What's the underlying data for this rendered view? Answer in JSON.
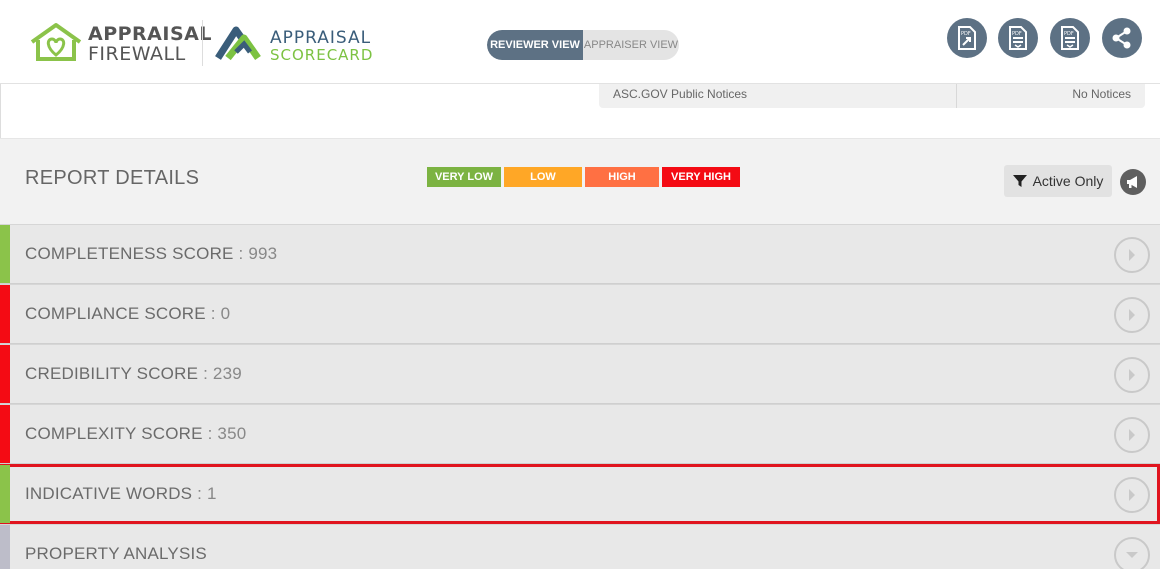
{
  "header": {
    "logo_firewall": {
      "line1": "APPRAISAL",
      "line2": "FIREWALL"
    },
    "logo_scorecard": {
      "line1": "APPRAISAL",
      "line2": "SCORECARD"
    },
    "view_toggle": {
      "active": "REVIEWER VIEW",
      "inactive": "APPRAISER VIEW"
    },
    "icons": [
      "pdf-export-icon",
      "pdf-download-icon",
      "pdf-file-icon",
      "share-icon"
    ]
  },
  "notices": {
    "label": "ASC.GOV Public Notices",
    "value": "No Notices"
  },
  "report_details": {
    "title": "REPORT DETAILS",
    "legend": [
      {
        "label": "VERY LOW",
        "color": "#7cb342"
      },
      {
        "label": "LOW",
        "color": "#ffa726"
      },
      {
        "label": "HIGH",
        "color": "#ff7043"
      },
      {
        "label": "VERY HIGH",
        "color": "#f40b14"
      }
    ],
    "filter_label": "Active Only"
  },
  "rows": [
    {
      "label": "COMPLETENESS SCORE",
      "score": " : 993",
      "color": "#8bc34a"
    },
    {
      "label": "COMPLIANCE SCORE",
      "score": " : 0",
      "color": "#f40b14"
    },
    {
      "label": "CREDIBILITY SCORE",
      "score": " : 239",
      "color": "#f40b14"
    },
    {
      "label": "COMPLEXITY SCORE",
      "score": " : 350",
      "color": "#f40b14"
    },
    {
      "label": "INDICATIVE WORDS",
      "score": " : 1",
      "color": "#8bc34a",
      "highlighted": true
    },
    {
      "label": "PROPERTY ANALYSIS",
      "score": "",
      "color": "#bdbdc9",
      "expand": "down"
    }
  ],
  "colors": {
    "accent": "#5d7184",
    "highlight": "#e0141e"
  }
}
